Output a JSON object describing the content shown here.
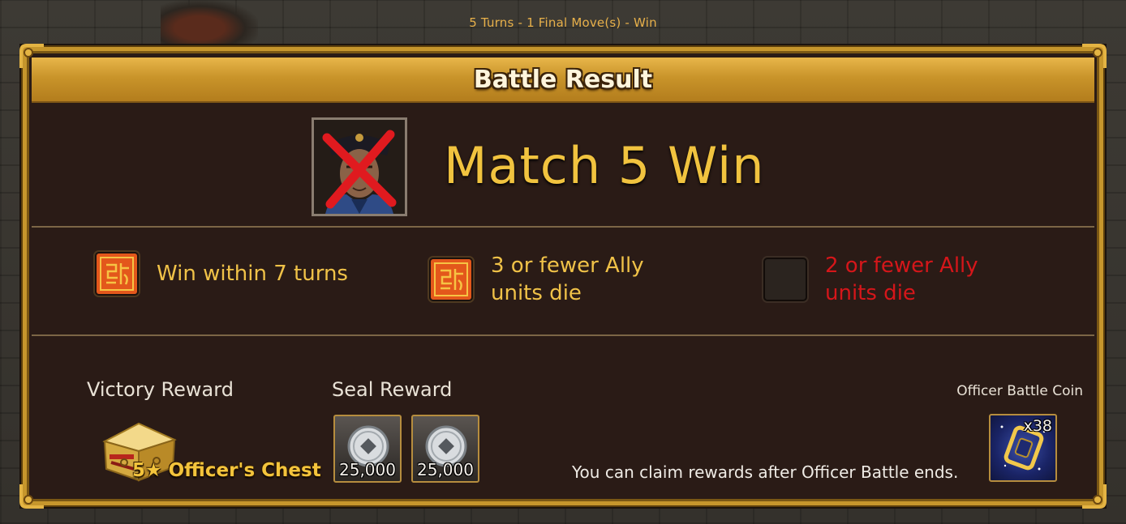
{
  "status_line": "5 Turns - 1 Final Move(s) - Win",
  "title": "Battle Result",
  "match": {
    "title": "Match 5 Win",
    "opponent_portrait_icon": "defeated-officer-portrait-icon"
  },
  "missions": [
    {
      "text": "Win within 7 turns",
      "completed": true,
      "icon": "seal-stamp-icon"
    },
    {
      "text": "3 or fewer Ally units die",
      "completed": true,
      "icon": "seal-stamp-icon"
    },
    {
      "text": "2 or fewer Ally units die",
      "completed": false,
      "icon": "empty-seal-slot"
    }
  ],
  "rewards": {
    "victory_label": "Victory Reward",
    "victory_item": "5★ Officer's Chest",
    "seal_label": "Seal Reward",
    "seal_items": [
      {
        "icon": "silver-coin-icon",
        "amount": "25,000"
      },
      {
        "icon": "silver-coin-icon",
        "amount": "25,000"
      }
    ],
    "coin_label": "Officer Battle Coin",
    "coin_qty": "x38",
    "claim_note": "You can claim rewards after Officer Battle ends."
  },
  "colors": {
    "gold_text": "#f1c33f",
    "fail_text": "#d5161a",
    "frame_gold": "#c6962c",
    "panel_bg": "#2a1b16"
  }
}
